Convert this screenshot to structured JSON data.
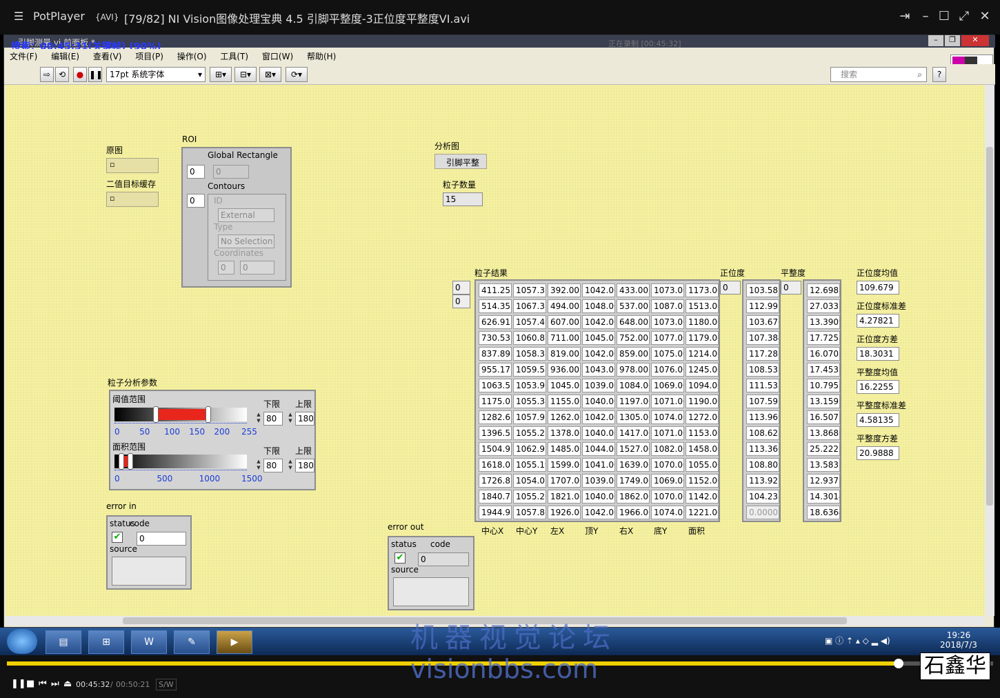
{
  "player": {
    "name": "PotPlayer",
    "format": "{AVI}",
    "file_title": "[79/82] NI Vision图像处理宝典 4.5 引脚平整度-3正位度平整度VI.avi",
    "current_time": "00:45:32",
    "total_time": "00:50:21",
    "sw": "S/W",
    "progress_fraction": 0.904,
    "clock_time": "19:26",
    "clock_date": "2018/7/3"
  },
  "lv": {
    "window_title": "引脚测量.vi 前面板 *",
    "search_overlay": "搜索：00:45:31(关键帧) (90%)",
    "recording_overlay": "正在录制 [00:45:32]",
    "menu": [
      "文件(F)",
      "编辑(E)",
      "查看(V)",
      "项目(P)",
      "操作(O)",
      "工具(T)",
      "窗口(W)",
      "帮助(H)"
    ],
    "font_select": "17pt 系统字体",
    "search_placeholder": "搜索"
  },
  "panel": {
    "orig_label": "原图",
    "bin_label": "二值目标缓存",
    "roi_label": "ROI",
    "roi_global_rect": "Global Rectangle",
    "roi_contours": "Contours",
    "roi_id": "ID",
    "roi_external": "External",
    "roi_type": "Type",
    "roi_no_sel": "No Selection",
    "roi_coords": "Coordinates",
    "zero": "0",
    "analysis_label": "分析图",
    "analysis_value": "引脚平整",
    "count_label": "粒子数量",
    "count_value": "15",
    "params_label": "粒子分析参数",
    "threshold_label": "阈值范围",
    "area_label": "面积范围",
    "lower_label": "下限",
    "upper_label": "上限",
    "thr_lower": "80",
    "thr_upper": "180",
    "area_lower": "80",
    "area_upper": "180",
    "thr_scale": [
      "0",
      "50",
      "100",
      "150",
      "200",
      "255"
    ],
    "area_scale": [
      "0",
      "500",
      "1000",
      "1500"
    ],
    "error_in_label": "error in",
    "error_out_label": "error out",
    "status_label": "status",
    "code_label": "code",
    "source_label": "source",
    "code_value": "0",
    "result_label": "粒子结果",
    "position_label": "正位度",
    "flat_label": "平整度",
    "columns": [
      "中心X",
      "中心Y",
      "左X",
      "顶Y",
      "右X",
      "底Y",
      "面积"
    ],
    "rows": [
      [
        "411.25",
        "1057.31",
        "392.00",
        "1042.00",
        "433.00",
        "1073.00",
        "1173.00"
      ],
      [
        "514.35",
        "1067.31",
        "494.00",
        "1048.00",
        "537.00",
        "1087.00",
        "1513.00"
      ],
      [
        "626.91",
        "1057.46",
        "607.00",
        "1042.00",
        "648.00",
        "1073.00",
        "1180.00"
      ],
      [
        "730.53",
        "1060.87",
        "711.00",
        "1045.00",
        "752.00",
        "1077.00",
        "1179.00"
      ],
      [
        "837.89",
        "1058.35",
        "819.00",
        "1042.00",
        "859.00",
        "1075.00",
        "1214.00"
      ],
      [
        "955.17",
        "1059.58",
        "936.00",
        "1043.00",
        "978.00",
        "1076.00",
        "1245.00"
      ],
      [
        "1063.55",
        "1053.96",
        "1045.00",
        "1039.00",
        "1084.00",
        "1069.00",
        "1094.00"
      ],
      [
        "1175.07",
        "1055.38",
        "1155.00",
        "1040.00",
        "1197.00",
        "1071.00",
        "1190.00"
      ],
      [
        "1282.63",
        "1057.95",
        "1262.00",
        "1042.00",
        "1305.00",
        "1074.00",
        "1272.00"
      ],
      [
        "1396.57",
        "1055.25",
        "1378.00",
        "1040.00",
        "1417.00",
        "1071.00",
        "1153.00"
      ],
      [
        "1504.92",
        "1062.92",
        "1485.00",
        "1044.00",
        "1527.00",
        "1082.00",
        "1458.00"
      ],
      [
        "1618.03",
        "1055.19",
        "1599.00",
        "1041.00",
        "1639.00",
        "1070.00",
        "1055.00"
      ],
      [
        "1726.83",
        "1054.07",
        "1707.00",
        "1039.00",
        "1749.00",
        "1069.00",
        "1152.00"
      ],
      [
        "1840.75",
        "1055.26",
        "1821.00",
        "1040.00",
        "1862.00",
        "1070.00",
        "1142.00"
      ],
      [
        "1944.95",
        "1057.86",
        "1926.00",
        "1042.00",
        "1966.00",
        "1074.00",
        "1221.00"
      ]
    ],
    "position": [
      "103.581",
      "112.991",
      "103.676",
      "107.384",
      "117.286",
      "108.531",
      "111.532",
      "107.593",
      "113.969",
      "108.623",
      "113.366",
      "108.805",
      "113.925",
      "104.238",
      "0.0000"
    ],
    "flatness": [
      "12.6983",
      "27.0332",
      "13.3909",
      "17.7258",
      "16.0705",
      "17.4538",
      "10.7953",
      "13.1593",
      "16.5072",
      "13.8680",
      "25.2223",
      "13.5831",
      "12.9375",
      "14.3014",
      "18.6364"
    ],
    "stats": [
      {
        "label": "正位度均值",
        "value": "109.679"
      },
      {
        "label": "正位度标准差",
        "value": "4.27821"
      },
      {
        "label": "正位度方差",
        "value": "18.3031"
      },
      {
        "label": "平整度均值",
        "value": "16.2255"
      },
      {
        "label": "平整度标准差",
        "value": "4.58135"
      },
      {
        "label": "平整度方差",
        "value": "20.9888"
      }
    ]
  },
  "watermark": {
    "cn": "机器视觉论坛",
    "en": "visionbbs.com",
    "stamp": "石鑫华"
  }
}
